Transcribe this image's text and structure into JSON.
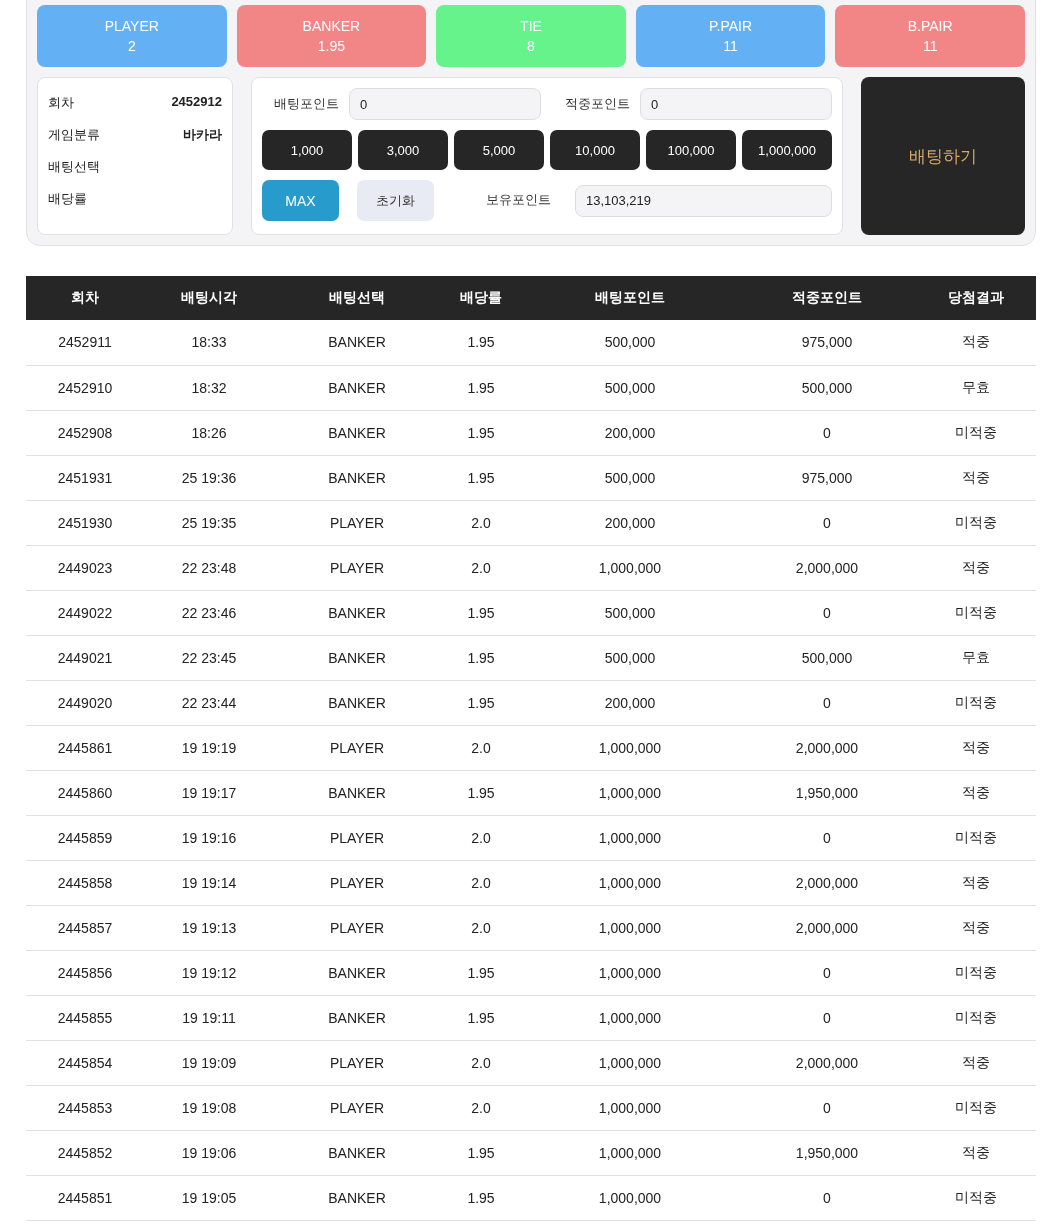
{
  "odds": [
    {
      "label": "PLAYER",
      "value": "2",
      "color": "#63b1f4"
    },
    {
      "label": "BANKER",
      "value": "1.95",
      "color": "#f28585"
    },
    {
      "label": "TIE",
      "value": "8",
      "color": "#66f38c"
    },
    {
      "label": "P.PAIR",
      "value": "11",
      "color": "#63b1f4"
    },
    {
      "label": "B.PAIR",
      "value": "11",
      "color": "#f28585"
    }
  ],
  "info": [
    {
      "label": "회차",
      "value": "2452912"
    },
    {
      "label": "게임분류",
      "value": "바카라"
    },
    {
      "label": "배팅선택"
    },
    {
      "label": "배당률"
    }
  ],
  "bet_form": {
    "bet_points": {
      "label": "배팅포인트",
      "value": "0"
    },
    "win_points": {
      "label": "적중포인트",
      "value": "0"
    },
    "chips": [
      "1,000",
      "3,000",
      "5,000",
      "10,000",
      "100,000",
      "1,000,000"
    ],
    "max_button": "MAX",
    "reset_button": "초기화",
    "held_points": {
      "label": "보유포인트",
      "value": "13,103,219"
    }
  },
  "bet_button": "배팅하기",
  "table": {
    "columns": [
      "회차",
      "배팅시각",
      "배팅선택",
      "배당률",
      "배팅포인트",
      "적중포인트",
      "당첨결과"
    ],
    "rows": [
      [
        "2452911",
        "18:33",
        "BANKER",
        "1.95",
        "500,000",
        "975,000",
        "적중"
      ],
      [
        "2452910",
        "18:32",
        "BANKER",
        "1.95",
        "500,000",
        "500,000",
        "무효"
      ],
      [
        "2452908",
        "18:26",
        "BANKER",
        "1.95",
        "200,000",
        "0",
        "미적중"
      ],
      [
        "2451931",
        "25 19:36",
        "BANKER",
        "1.95",
        "500,000",
        "975,000",
        "적중"
      ],
      [
        "2451930",
        "25 19:35",
        "PLAYER",
        "2.0",
        "200,000",
        "0",
        "미적중"
      ],
      [
        "2449023",
        "22 23:48",
        "PLAYER",
        "2.0",
        "1,000,000",
        "2,000,000",
        "적중"
      ],
      [
        "2449022",
        "22 23:46",
        "BANKER",
        "1.95",
        "500,000",
        "0",
        "미적중"
      ],
      [
        "2449021",
        "22 23:45",
        "BANKER",
        "1.95",
        "500,000",
        "500,000",
        "무효"
      ],
      [
        "2449020",
        "22 23:44",
        "BANKER",
        "1.95",
        "200,000",
        "0",
        "미적중"
      ],
      [
        "2445861",
        "19 19:19",
        "PLAYER",
        "2.0",
        "1,000,000",
        "2,000,000",
        "적중"
      ],
      [
        "2445860",
        "19 19:17",
        "BANKER",
        "1.95",
        "1,000,000",
        "1,950,000",
        "적중"
      ],
      [
        "2445859",
        "19 19:16",
        "PLAYER",
        "2.0",
        "1,000,000",
        "0",
        "미적중"
      ],
      [
        "2445858",
        "19 19:14",
        "PLAYER",
        "2.0",
        "1,000,000",
        "2,000,000",
        "적중"
      ],
      [
        "2445857",
        "19 19:13",
        "PLAYER",
        "2.0",
        "1,000,000",
        "2,000,000",
        "적중"
      ],
      [
        "2445856",
        "19 19:12",
        "BANKER",
        "1.95",
        "1,000,000",
        "0",
        "미적중"
      ],
      [
        "2445855",
        "19 19:11",
        "BANKER",
        "1.95",
        "1,000,000",
        "0",
        "미적중"
      ],
      [
        "2445854",
        "19 19:09",
        "PLAYER",
        "2.0",
        "1,000,000",
        "2,000,000",
        "적중"
      ],
      [
        "2445853",
        "19 19:08",
        "PLAYER",
        "2.0",
        "1,000,000",
        "0",
        "미적중"
      ],
      [
        "2445852",
        "19 19:06",
        "BANKER",
        "1.95",
        "1,000,000",
        "1,950,000",
        "적중"
      ],
      [
        "2445851",
        "19 19:05",
        "BANKER",
        "1.95",
        "1,000,000",
        "0",
        "미적중"
      ]
    ]
  }
}
